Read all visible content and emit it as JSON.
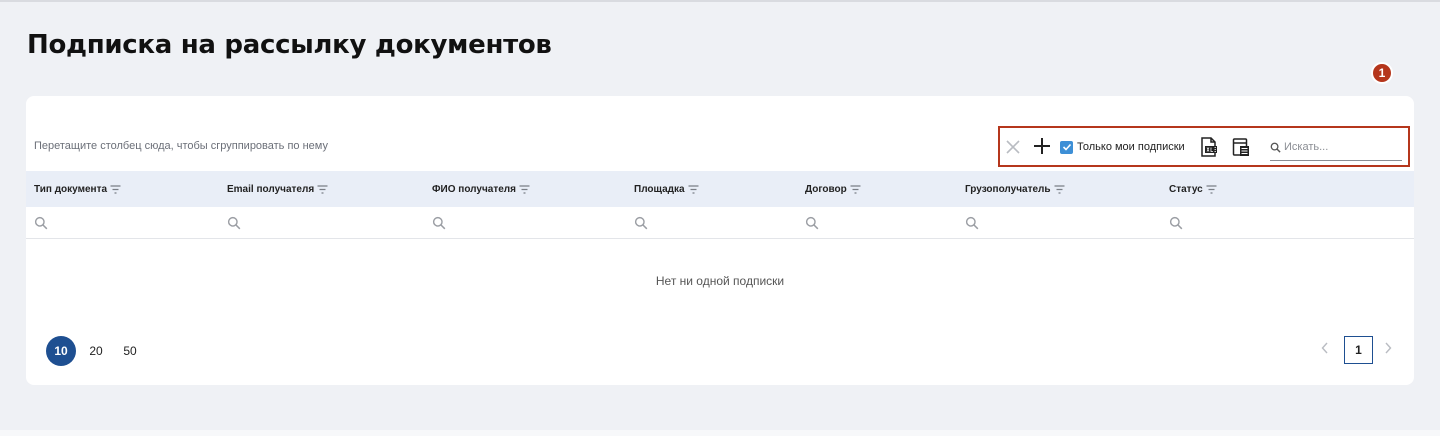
{
  "page": {
    "title": "Подписка на рассылку документов"
  },
  "grid": {
    "group_hint": "Перетащите столбец сюда, чтобы сгруппировать по нему",
    "toolbar": {
      "only_mine_label": "Только мои подписки",
      "only_mine_checked": true,
      "search_placeholder": "Искать...",
      "badge": "1"
    },
    "columns": [
      {
        "label": "Тип документа"
      },
      {
        "label": "Email получателя"
      },
      {
        "label": "ФИО получателя"
      },
      {
        "label": "Площадка"
      },
      {
        "label": "Договор"
      },
      {
        "label": "Грузополучатель"
      },
      {
        "label": "Статус"
      }
    ],
    "empty_message": "Нет ни одной подписки",
    "page_sizes": [
      "10",
      "20",
      "50"
    ],
    "selected_page_size": "10",
    "current_page": "1"
  },
  "colors": {
    "accent": "#1e4f91",
    "highlight": "#b5361c",
    "header_bg": "#e9eef7",
    "checkbox": "#3d8fd6"
  },
  "icons": [
    "clear-icon",
    "add-icon",
    "checkbox-checked-icon",
    "export-xlsx-icon",
    "column-chooser-icon",
    "search-icon",
    "filter-icon",
    "chevron-left-icon",
    "chevron-right-icon"
  ]
}
